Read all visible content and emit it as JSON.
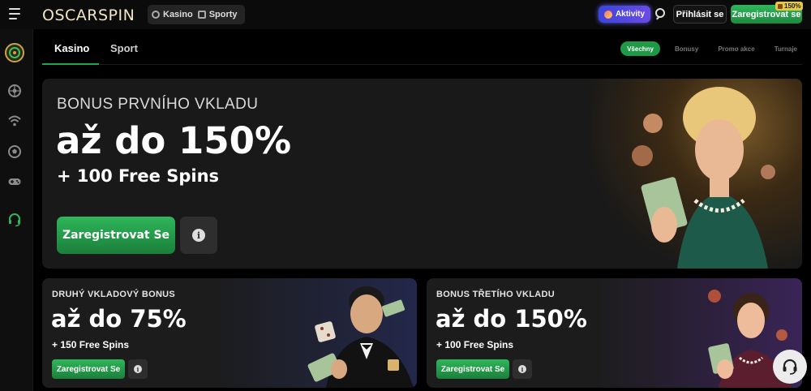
{
  "header": {
    "logo_text": "OSCARSPIN",
    "modes": [
      {
        "label": "Kasino",
        "icon": "roulette-icon"
      },
      {
        "label": "Sporty",
        "icon": "sports-icon"
      }
    ],
    "activity_label": "Aktivity",
    "login_label": "Přihlásit se",
    "register_label": "Zaregistrovat se",
    "register_badge": "150%"
  },
  "sidebar": {
    "items": [
      {
        "icon": "promo-wheel-icon"
      },
      {
        "icon": "roulette-icon"
      },
      {
        "icon": "live-signal-icon"
      },
      {
        "icon": "soccer-ball-icon"
      },
      {
        "icon": "gamepad-icon"
      },
      {
        "icon": "support-headset-icon"
      }
    ]
  },
  "subnav": {
    "tabs": [
      {
        "label": "Kasino",
        "active": true
      },
      {
        "label": "Sport",
        "active": false
      }
    ],
    "filters": [
      {
        "label": "Všechny",
        "active": true
      },
      {
        "label": "Bonusy",
        "active": false
      },
      {
        "label": "Promo akce",
        "active": false
      },
      {
        "label": "Turnaje",
        "active": false
      }
    ]
  },
  "hero": {
    "kicker": "BONUS PRVNÍHO VKLADU",
    "amount": "až do 150%",
    "sub": "+ 100 Free Spins",
    "cta": "Zaregistrovat Se",
    "info": "i"
  },
  "cards": [
    {
      "kicker": "DRUHÝ VKLADOVÝ BONUS",
      "amount": "až do 75%",
      "sub": "+ 150 Free Spins",
      "cta": "Zaregistrovat Se",
      "info": "i"
    },
    {
      "kicker": "BONUS TŘETÍHO VKLADU",
      "amount": "až do 150%",
      "sub": "+ 100 Free Spins",
      "cta": "Zaregistrovat Se",
      "info": "i"
    }
  ],
  "colors": {
    "accent_green": "#1fa64c",
    "activity_purple": "#5a4ae0",
    "badge_gold": "#e7c94a"
  }
}
